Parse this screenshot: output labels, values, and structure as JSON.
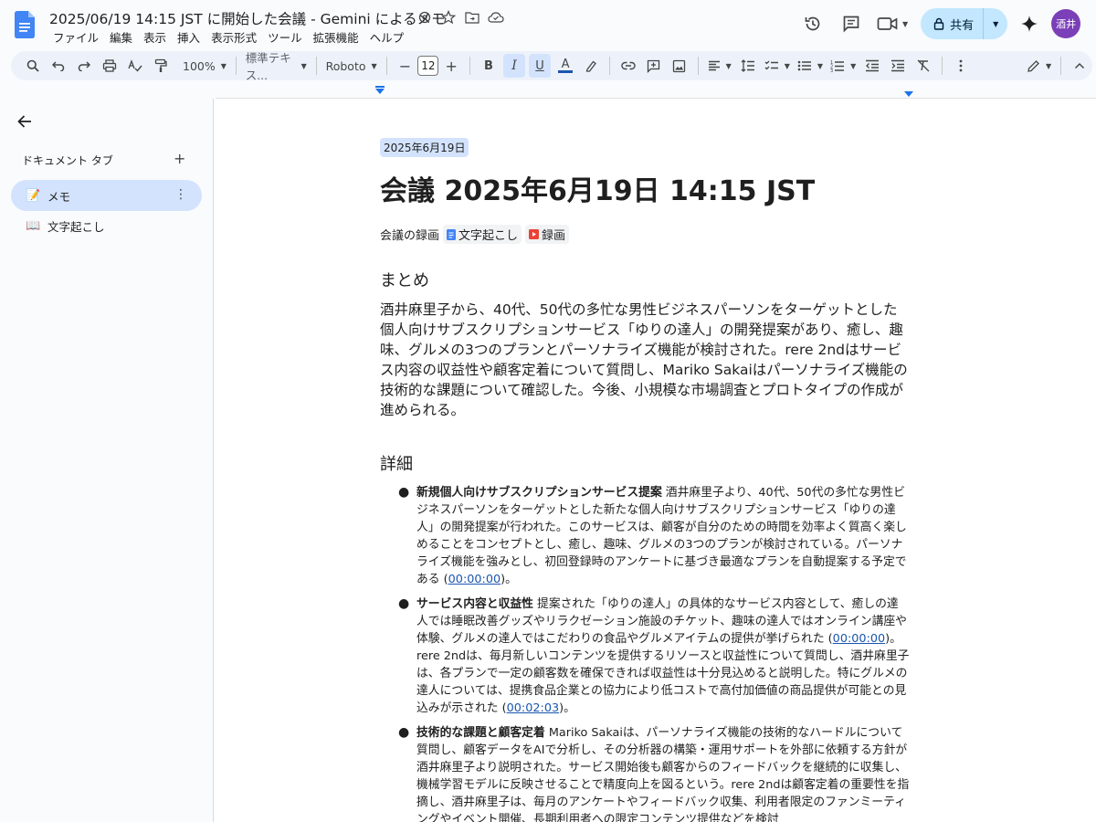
{
  "doc": {
    "title": "2025/06/19 14:15 JST に開始した会議 - Gemini によるメモ"
  },
  "menu": [
    "ファイル",
    "編集",
    "表示",
    "挿入",
    "表示形式",
    "ツール",
    "拡張機能",
    "ヘルプ"
  ],
  "share": {
    "label": "共有"
  },
  "user": {
    "initials": "酒井",
    "color": "#7b3fb8"
  },
  "toolbar": {
    "zoom": "100%",
    "style": "標準テキス...",
    "font": "Roboto",
    "font_size": "12",
    "bold": "B",
    "italic": "I",
    "underline": "U",
    "text_color": "A"
  },
  "sidebar": {
    "heading": "ドキュメント タブ",
    "add": "+",
    "tabs": [
      {
        "icon": "📝",
        "label": "メモ",
        "selected": true
      },
      {
        "icon": "📖",
        "label": "文字起こし",
        "selected": false
      }
    ]
  },
  "page": {
    "date_chip": "2025年6月19日",
    "heading": "会議 2025年6月19日 14:15 JST",
    "recording_label": "会議の録画",
    "chip_transcript": "文字起こし",
    "chip_recording": "録画",
    "summary_heading": "まとめ",
    "summary": "酒井麻里子から、40代、50代の多忙な男性ビジネスパーソンをターゲットとした個人向けサブスクリプションサービス「ゆりの達人」の開発提案があり、癒し、趣味、グルメの3つのプランとパーソナライズ機能が検討された。rere 2ndはサービス内容の収益性や顧客定着について質問し、Mariko Sakaiはパーソナライズ機能の技術的な課題について確認した。今後、小規模な市場調査とプロトタイプの作成が進められる。",
    "details_heading": "詳細",
    "details": [
      {
        "title": "新規個人向けサブスクリプションサービス提案",
        "text": " 酒井麻里子より、40代、50代の多忙な男性ビジネスパーソンをターゲットとした新たな個人向けサブスクリプションサービス「ゆりの達人」の開発提案が行われた。このサービスは、顧客が自分のための時間を効率よく質高く楽しめることをコンセプトとし、癒し、趣味、グルメの3つのプランが検討されている。パーソナライズ機能を強みとし、初回登録時のアンケートに基づき最適なプランを自動提案する予定である (",
        "link": "00:00:00",
        "tail": ")。"
      },
      {
        "title": "サービス内容と収益性",
        "text": " 提案された「ゆりの達人」の具体的なサービス内容として、癒しの達人では睡眠改善グッズやリラクゼーション施設のチケット、趣味の達人ではオンライン講座や体験、グルメの達人ではこだわりの食品やグルメアイテムの提供が挙げられた (",
        "link": "00:00:00",
        "text2": ")。rere 2ndは、毎月新しいコンテンツを提供するリソースと収益性について質問し、酒井麻里子は、各プランで一定の顧客数を確保できれば収益性は十分見込めると説明した。特にグルメの達人については、提携食品企業との協力により低コストで高付加価値の商品提供が可能との見込みが示された (",
        "link2": "00:02:03",
        "tail": ")。"
      },
      {
        "title": "技術的な課題と顧客定着",
        "text": " Mariko Sakaiは、パーソナライズ機能の技術的なハードルについて質問し、顧客データをAIで分析し、その分析器の構築・運用サポートを外部に依頼する方針が酒井麻里子より説明された。サービス開始後も顧客からのフィードバックを継続的に収集し、機械学習モデルに反映させることで精度向上を図るという。rere 2ndは顧客定着の重要性を指摘し、酒井麻里子は、毎月のアンケートやフィードバック収集、利用者限定のファンミーティングやイベント開催、長期利用者への限定コンテンツ提供などを検討"
      }
    ]
  }
}
